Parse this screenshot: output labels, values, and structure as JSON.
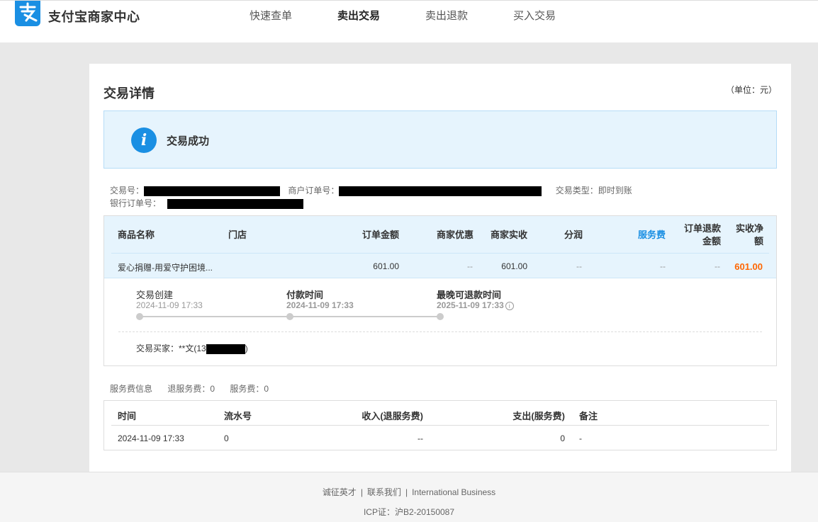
{
  "header": {
    "brand": "支付宝商家中心",
    "nav": [
      "快速查单",
      "卖出交易",
      "卖出退款",
      "买入交易"
    ],
    "active_nav": "卖出交易"
  },
  "page": {
    "title": "交易详情",
    "unit": "（单位：元）",
    "status": "交易成功"
  },
  "meta": {
    "trade_no_label": "交易号：",
    "merchant_order_label": "商户订单号：",
    "trade_type_label": "交易类型：",
    "trade_type_value": "即时到账",
    "bank_order_label": "银行订单号："
  },
  "order_table": {
    "headers": {
      "product": "商品名称",
      "store": "门店",
      "order_amount": "订单金额",
      "merchant_discount": "商家优惠",
      "merchant_received": "商家实收",
      "profit_share": "分润",
      "service_fee": "服务费",
      "refund_amount": "订单退款金额",
      "net_received": "实收净额"
    },
    "row": {
      "product": "爱心捐赠-用爱守护困境...",
      "store": "",
      "order_amount": "601.00",
      "merchant_discount": "--",
      "merchant_received": "601.00",
      "profit_share": "--",
      "service_fee": "--",
      "refund_amount": "--",
      "net_received": "601.00"
    }
  },
  "timeline": [
    {
      "label": "交易创建",
      "time": "2024-11-09 17:33"
    },
    {
      "label": "付款时间",
      "time": "2024-11-09 17:33"
    },
    {
      "label": "最晚可退款时间",
      "time": "2025-11-09 17:33"
    }
  ],
  "buyer": {
    "label": "交易买家：",
    "prefix": "**文(13",
    "suffix": ")"
  },
  "fee_info": {
    "title": "服务费信息",
    "refund_fee": "退服务费：0",
    "fee": "服务费：0"
  },
  "fee_table": {
    "headers": {
      "time": "时间",
      "serial": "流水号",
      "income": "收入(退服务费)",
      "expense": "支出(服务费)",
      "note": "备注"
    },
    "row": {
      "time": "2024-11-09 17:33",
      "serial": "0",
      "income": "--",
      "expense": "0",
      "note": "-"
    }
  },
  "footer": {
    "links": [
      "诚征英才",
      "联系我们",
      "International Business"
    ],
    "icp": "ICP证：沪B2-20150087"
  },
  "colors": {
    "brand_blue": "#1a8fe3",
    "amount_orange": "#ff6600",
    "status_bg": "#e6f4fd"
  }
}
